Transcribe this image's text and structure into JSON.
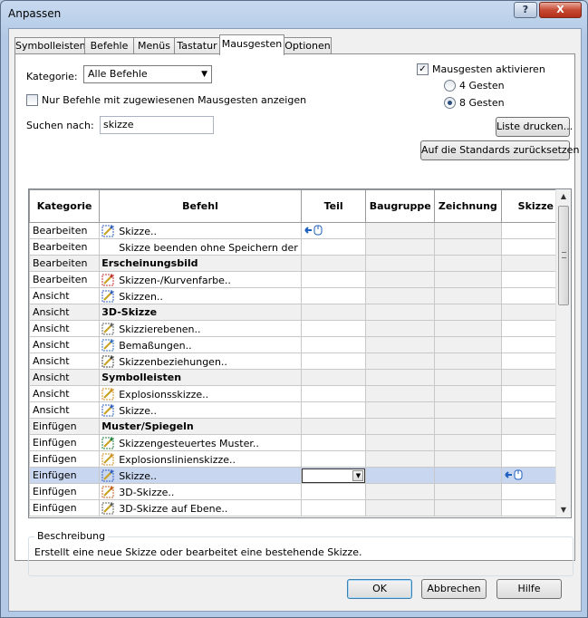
{
  "window": {
    "title": "Anpassen"
  },
  "title_buttons": {
    "help": "?",
    "close": "X"
  },
  "tabs": [
    "Symbolleisten",
    "Befehle",
    "Menüs",
    "Tastatur",
    "Mausgesten",
    "Optionen"
  ],
  "active_tab": "Mausgesten",
  "filters": {
    "category_label": "Kategorie:",
    "category_value": "Alle Befehle",
    "only_assigned_label": "Nur Befehle mit zugewiesenen Mausgesten anzeigen",
    "only_assigned_checked": false,
    "search_label": "Suchen nach:",
    "search_value": "skizze"
  },
  "gestures": {
    "enable_label": "Mausgesten aktivieren",
    "enabled": true,
    "option_4": "4 Gesten",
    "option_8": "8 Gesten",
    "selected": "8 Gesten"
  },
  "buttons": {
    "print_list": "Liste drucken...",
    "reset_defaults": "Auf die Standards zurücksetzen",
    "ok": "OK",
    "cancel": "Abbrechen",
    "help": "Hilfe"
  },
  "table": {
    "columns": [
      "Kategorie",
      "Befehl",
      "Teil",
      "Baugruppe",
      "Zeichnung",
      "Skizze"
    ],
    "rows": [
      {
        "kategorie": "Bearbeiten",
        "befehl": "Skizze..",
        "icon": "sketch-icon",
        "group": false,
        "teil_gesture": "mouse-gesture-left-icon",
        "skizze_gesture": ""
      },
      {
        "kategorie": "Bearbeiten",
        "befehl": "Skizze beenden ohne Speichern der",
        "icon": "",
        "group": false,
        "teil_gesture": "",
        "skizze_gesture": ""
      },
      {
        "kategorie": "Bearbeiten",
        "befehl": "Erscheinungsbild",
        "icon": "",
        "group": true,
        "teil_gesture": "",
        "skizze_gesture": ""
      },
      {
        "kategorie": "Bearbeiten",
        "befehl": "Skizzen-/Kurvenfarbe..",
        "icon": "sketch-color-icon",
        "group": false,
        "teil_gesture": "",
        "skizze_gesture": ""
      },
      {
        "kategorie": "Ansicht",
        "befehl": "Skizzen..",
        "icon": "sketches-view-icon",
        "group": false,
        "teil_gesture": "",
        "skizze_gesture": ""
      },
      {
        "kategorie": "Ansicht",
        "befehl": "3D-Skizze",
        "icon": "",
        "group": true,
        "teil_gesture": "",
        "skizze_gesture": ""
      },
      {
        "kategorie": "Ansicht",
        "befehl": "Skizzierebenen..",
        "icon": "sketch-planes-icon",
        "group": false,
        "teil_gesture": "",
        "skizze_gesture": ""
      },
      {
        "kategorie": "Ansicht",
        "befehl": "Bemaßungen..",
        "icon": "dimensions-icon",
        "group": false,
        "teil_gesture": "",
        "skizze_gesture": ""
      },
      {
        "kategorie": "Ansicht",
        "befehl": "Skizzenbeziehungen..",
        "icon": "sketch-relations-icon",
        "group": false,
        "teil_gesture": "",
        "skizze_gesture": ""
      },
      {
        "kategorie": "Ansicht",
        "befehl": "Symbolleisten",
        "icon": "",
        "group": true,
        "teil_gesture": "",
        "skizze_gesture": ""
      },
      {
        "kategorie": "Ansicht",
        "befehl": "Explosionsskizze..",
        "icon": "explode-sketch-icon",
        "group": false,
        "teil_gesture": "",
        "skizze_gesture": ""
      },
      {
        "kategorie": "Ansicht",
        "befehl": "Skizze..",
        "icon": "sketch-toolbar-icon",
        "group": false,
        "teil_gesture": "",
        "skizze_gesture": ""
      },
      {
        "kategorie": "Einfügen",
        "befehl": "Muster/Spiegeln",
        "icon": "",
        "group": true,
        "teil_gesture": "",
        "skizze_gesture": ""
      },
      {
        "kategorie": "Einfügen",
        "befehl": "Skizzengesteuertes Muster..",
        "icon": "sketch-pattern-icon",
        "group": false,
        "teil_gesture": "",
        "skizze_gesture": ""
      },
      {
        "kategorie": "Einfügen",
        "befehl": "Explosionslinienskizze..",
        "icon": "explode-line-icon",
        "group": false,
        "teil_gesture": "",
        "skizze_gesture": ""
      },
      {
        "kategorie": "Einfügen",
        "befehl": "Skizze..",
        "icon": "sketch-icon",
        "group": false,
        "selected": true,
        "teil_gesture": "combo",
        "skizze_gesture": "mouse-gesture-left-icon"
      },
      {
        "kategorie": "Einfügen",
        "befehl": "3D-Skizze..",
        "icon": "sketch-3d-icon",
        "group": false,
        "teil_gesture": "",
        "skizze_gesture": ""
      },
      {
        "kategorie": "Einfügen",
        "befehl": "3D-Skizze auf Ebene..",
        "icon": "sketch-3d-plane-icon",
        "group": false,
        "teil_gesture": "",
        "skizze_gesture": ""
      }
    ]
  },
  "description": {
    "label": "Beschreibung",
    "text": "Erstellt eine neue Skizze oder bearbeitet eine bestehende Skizze."
  },
  "colors": {
    "selected_row": "#c9d6ef",
    "group_row": "#f0f0f0"
  }
}
